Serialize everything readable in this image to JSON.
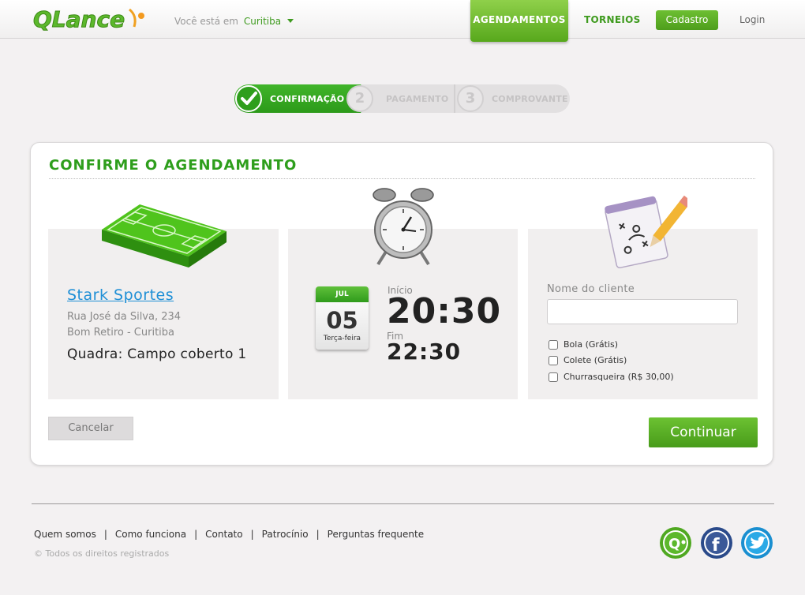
{
  "header": {
    "logo_text": "QLance",
    "location_prefix": "Você está em",
    "location_city": "Curitiba",
    "nav_agendamentos": "AGENDAMENTOS",
    "nav_torneios": "TORNEIOS",
    "nav_cadastro": "Cadastro",
    "nav_login": "Login"
  },
  "stepper": {
    "steps": [
      {
        "number": "✓",
        "label": "CONFIRMAÇÃO",
        "state": "active"
      },
      {
        "number": "2",
        "label": "PAGAMENTO",
        "state": "inactive"
      },
      {
        "number": "3",
        "label": "COMPROVANTE",
        "state": "inactive"
      }
    ]
  },
  "main": {
    "title": "CONFIRME O AGENDAMENTO",
    "venue": {
      "name": "Stark Sportes",
      "address_line1": "Rua José da Silva, 234",
      "address_line2": "Bom Retiro - Curitiba",
      "court": "Quadra: Campo coberto 1",
      "icon": "soccer-field-icon"
    },
    "schedule": {
      "icon": "alarm-clock-icon",
      "month": "JUL",
      "day": "05",
      "weekday": "Terça-feira",
      "start_label": "Início",
      "start_time": "20:30",
      "end_label": "Fim",
      "end_time": "22:30"
    },
    "client": {
      "icon": "tactics-pad-icon",
      "name_label": "Nome do cliente",
      "name_value": "",
      "options": [
        {
          "label": "Bola (Grátis)",
          "checked": false
        },
        {
          "label": "Colete (Grátis)",
          "checked": false
        },
        {
          "label": "Churrasqueira (R$ 30,00)",
          "checked": false
        }
      ]
    },
    "cancel_label": "Cancelar",
    "continue_label": "Continuar"
  },
  "footer": {
    "links": [
      "Quem somos",
      "Como funciona",
      "Contato",
      "Patrocínio",
      "Perguntas frequente"
    ],
    "copyright": "© Todos os direitos registrados",
    "social": [
      "qlance-icon",
      "facebook-icon",
      "twitter-icon"
    ]
  },
  "colors": {
    "brand_green": "#2e9e1c",
    "link_blue": "#1f8fd6",
    "background": "#f3f1f2"
  }
}
